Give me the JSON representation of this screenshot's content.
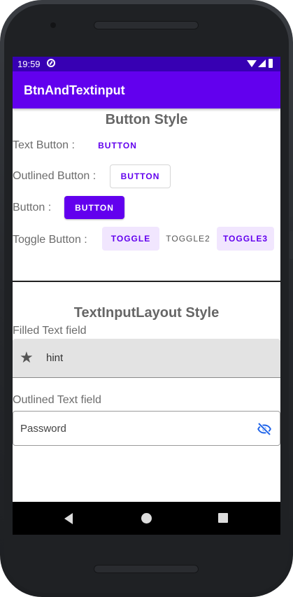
{
  "status_bar": {
    "time": "19:59"
  },
  "app_bar": {
    "title": "BtnAndTextinput"
  },
  "button_section": {
    "title": "Button Style",
    "text_button": {
      "label": "Text Button :",
      "button": "BUTTON"
    },
    "outlined_button": {
      "label": "Outlined Button :",
      "button": "BUTTON"
    },
    "filled_button": {
      "label": "Button :",
      "button": "BUTTON"
    },
    "toggle_group": {
      "label": "Toggle Button :",
      "toggles": [
        "TOGGLE",
        "TOGGLE2",
        "TOGGLE3"
      ],
      "checked": [
        "TOGGLE",
        "TOGGLE3"
      ]
    }
  },
  "text_input_section": {
    "title": "TextInputLayout Style",
    "filled": {
      "label": "Filled Text field",
      "hint": "hint",
      "icon": "star-icon"
    },
    "outlined": {
      "label": "Outlined Text field",
      "placeholder": "Password",
      "icon": "visibility-off-icon"
    }
  },
  "colors": {
    "primary": "#6200ee",
    "primary_dark": "#3700b3",
    "toggle_checked_bg": "#f1e6fe"
  }
}
